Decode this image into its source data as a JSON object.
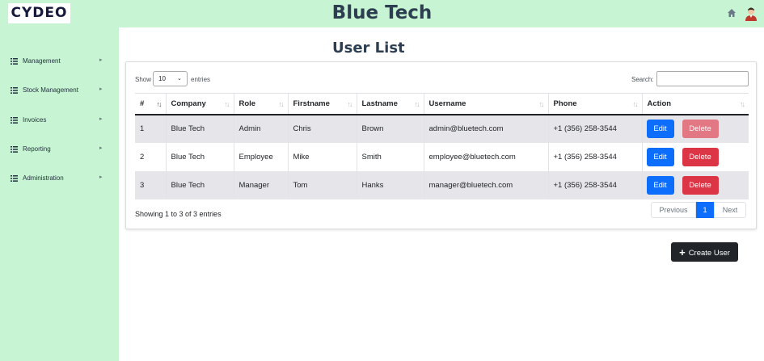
{
  "header": {
    "logo": "CYDEO",
    "title": "Blue Tech"
  },
  "sidebar": {
    "items": [
      {
        "label": "Management"
      },
      {
        "label": "Stock Management"
      },
      {
        "label": "Invoices"
      },
      {
        "label": "Reporting"
      },
      {
        "label": "Administration"
      }
    ]
  },
  "page": {
    "title": "User List"
  },
  "table_controls": {
    "show_label": "Show",
    "entries_value": "10",
    "entries_label": "entries",
    "search_label": "Search:",
    "search_value": ""
  },
  "table": {
    "columns": [
      "#",
      "Company",
      "Role",
      "Firstname",
      "Lastname",
      "Username",
      "Phone",
      "Action"
    ],
    "rows": [
      [
        "1",
        "Blue Tech",
        "Admin",
        "Chris",
        "Brown",
        "admin@bluetech.com",
        "+1 (356) 258-3544"
      ],
      [
        "2",
        "Blue Tech",
        "Employee",
        "Mike",
        "Smith",
        "employee@bluetech.com",
        "+1 (356) 258-3544"
      ],
      [
        "3",
        "Blue Tech",
        "Manager",
        "Tom",
        "Hanks",
        "manager@bluetech.com",
        "+1 (356) 258-3544"
      ]
    ],
    "edit_label": "Edit",
    "delete_label": "Delete"
  },
  "footer": {
    "info": "Showing 1 to 3 of 3 entries",
    "previous": "Previous",
    "current_page": "1",
    "next": "Next"
  },
  "create_button": {
    "label": "Create User"
  },
  "colors": {
    "accent_green": "#c7f5d3",
    "primary": "#0d6efd",
    "danger": "#dc3545",
    "dark": "#212529"
  }
}
